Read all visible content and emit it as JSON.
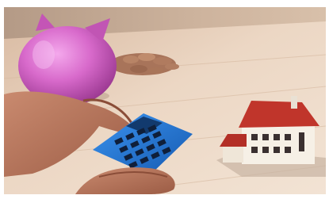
{
  "scene": {
    "kind": "photograph",
    "subjects": [
      "piggy-bank",
      "coins-pile",
      "hands",
      "calculator",
      "house-model"
    ],
    "colors": {
      "table": "#e8cfb8",
      "piggy": "#d46bc7",
      "calculator": "#2378d6",
      "roof": "#c0352b",
      "walls": "#f6f0e6"
    }
  }
}
